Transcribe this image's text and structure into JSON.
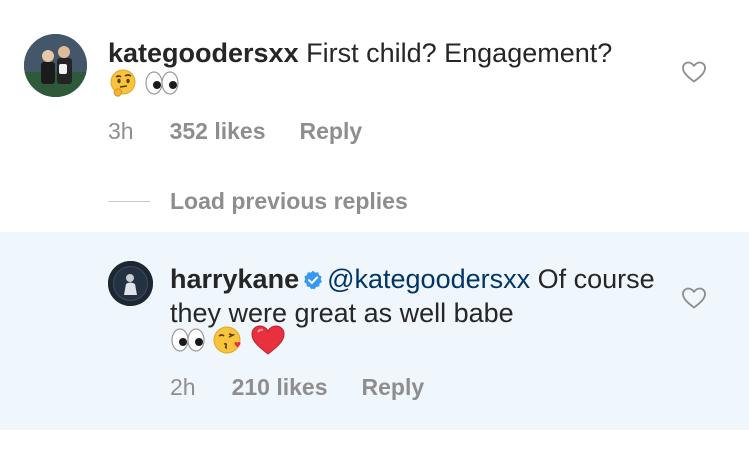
{
  "comments": [
    {
      "username": "kategoodersxx",
      "text": "First child? Engagement?",
      "emojis": [
        "thinking-face",
        "eyes"
      ],
      "time": "3h",
      "likes": "352 likes",
      "reply_label": "Reply"
    },
    {
      "username": "harrykane",
      "verified": true,
      "mention": "@kategoodersxx",
      "text": "Of course they were great as well babe",
      "emojis": [
        "eyes",
        "face-blowing-kiss",
        "red-heart"
      ],
      "time": "2h",
      "likes": "210 likes",
      "reply_label": "Reply"
    }
  ],
  "load_previous_label": "Load previous replies",
  "colors": {
    "text": "#262626",
    "muted": "#8e8e8e",
    "mention": "#003569",
    "highlight_bg": "#eff6fc",
    "verified": "#3897f0",
    "heart_red": "#ed3040"
  }
}
